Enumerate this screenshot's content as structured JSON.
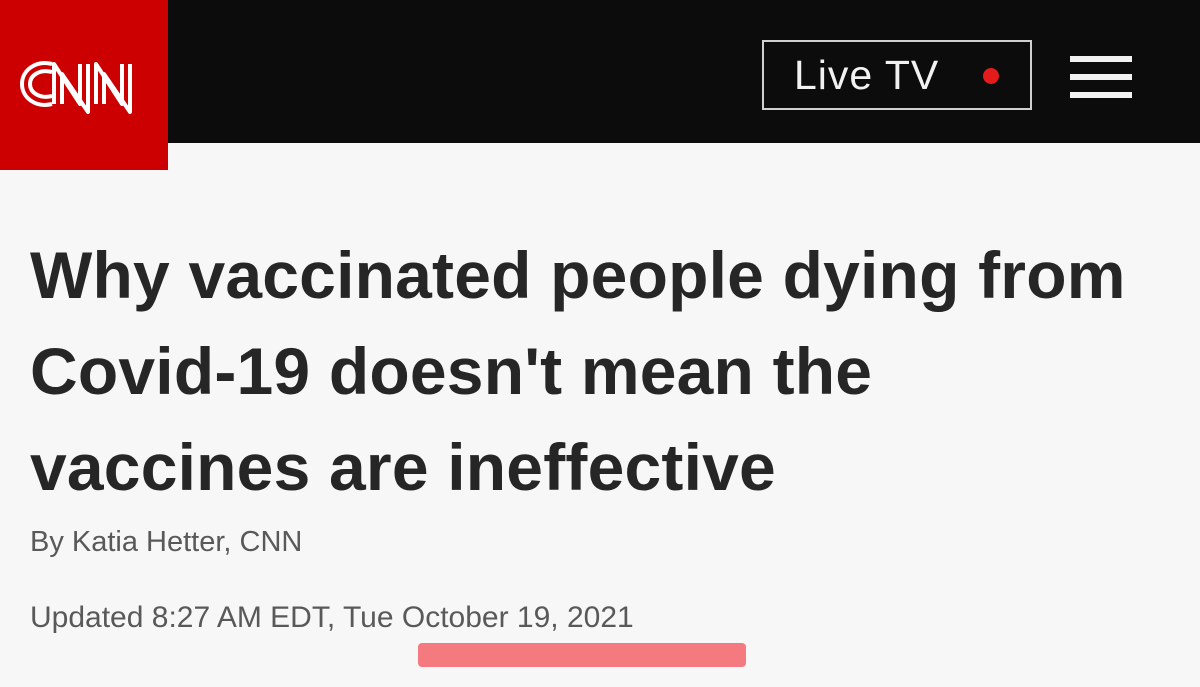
{
  "header": {
    "logo_text": "CNN",
    "live_tv_label": "Live TV",
    "brand_color": "#cc0000",
    "live_dot_color": "#e31b1b",
    "menu_icon": "hamburger-menu-icon"
  },
  "article": {
    "headline": "Why vaccinated people dying from Covid-19 doesn't mean the vaccines are ineffective",
    "byline": "By Katia Hetter, CNN",
    "updated": "Updated 8:27 AM EDT, Tue October 19, 2021"
  },
  "annotation": {
    "highlight_color": "#f4646a"
  }
}
